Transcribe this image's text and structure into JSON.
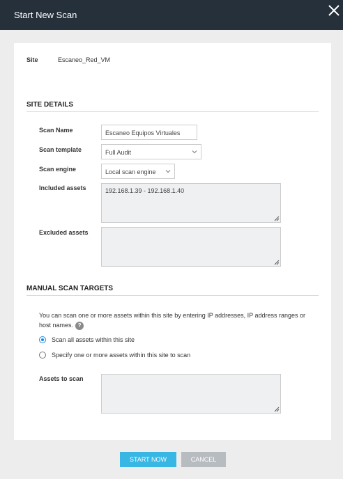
{
  "dialog": {
    "title": "Start New Scan"
  },
  "site": {
    "label": "Site",
    "value": "Escaneo_Red_VM"
  },
  "site_details": {
    "heading": "SITE DETAILS",
    "scan_name": {
      "label": "Scan Name",
      "value": "Escaneo Equipos Virtuales"
    },
    "scan_template": {
      "label": "Scan template",
      "value": "Full Audit"
    },
    "scan_engine": {
      "label": "Scan engine",
      "value": "Local scan engine"
    },
    "included_assets": {
      "label": "Included assets",
      "value": "192.168.1.39 - 192.168.1.40"
    },
    "excluded_assets": {
      "label": "Excluded assets",
      "value": ""
    }
  },
  "manual_targets": {
    "heading": "MANUAL SCAN TARGETS",
    "description": "You can scan one or more assets within this site by entering IP addresses, IP address ranges or host names.",
    "help_glyph": "?",
    "options": [
      {
        "label": "Scan all assets within this site",
        "selected": true
      },
      {
        "label": "Specify one or more assets within this site to scan",
        "selected": false
      }
    ],
    "assets_to_scan": {
      "label": "Assets to scan",
      "value": ""
    }
  },
  "buttons": {
    "start": "START NOW",
    "cancel": "CANCEL"
  },
  "colors": {
    "titlebar": "#25303b",
    "accent": "#38b6e4",
    "cancel": "#b7bcc1",
    "radio": "#1e88e5"
  }
}
